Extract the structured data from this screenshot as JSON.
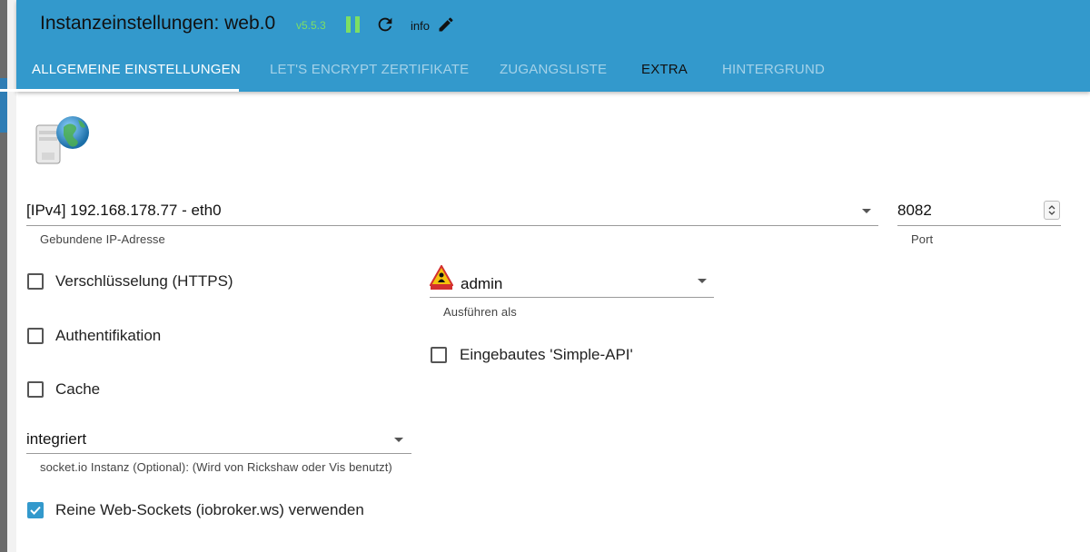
{
  "header": {
    "title": "Instanzeinstellungen: web.0",
    "version": "v5.5.3",
    "info_label": "info",
    "icons": [
      "pause-icon",
      "reload-icon",
      "edit-icon"
    ],
    "version_color": "#7ddf64",
    "bar_color": "#3399cc"
  },
  "tabs": [
    {
      "label": "ALLGEMEINE EINSTELLUNGEN",
      "active": true
    },
    {
      "label": "LET'S ENCRYPT ZERTIFIKATE",
      "active": false
    },
    {
      "label": "ZUGANGSLISTE",
      "active": false
    },
    {
      "label": "EXTRA",
      "active": false
    },
    {
      "label": "HINTERGRUND",
      "active": false
    }
  ],
  "form": {
    "ip": {
      "value": "[IPv4] 192.168.178.77 - eth0",
      "helper": "Gebundene IP-Adresse"
    },
    "port": {
      "value": "8082",
      "helper": "Port"
    },
    "run_as": {
      "value": "admin",
      "helper": "Ausführen als"
    },
    "https": {
      "label": "Verschlüsselung (HTTPS)",
      "checked": false
    },
    "auth": {
      "label": "Authentifikation",
      "checked": false
    },
    "cache": {
      "label": "Cache",
      "checked": false
    },
    "simple_api": {
      "label": "Eingebautes 'Simple-API'",
      "checked": false
    },
    "socketio": {
      "value": "integriert",
      "helper": "socket.io Instanz (Optional): (Wird von Rickshaw oder Vis benutzt)"
    },
    "pure_ws": {
      "label": "Reine Web-Sockets (iobroker.ws) verwenden",
      "checked": true
    }
  }
}
